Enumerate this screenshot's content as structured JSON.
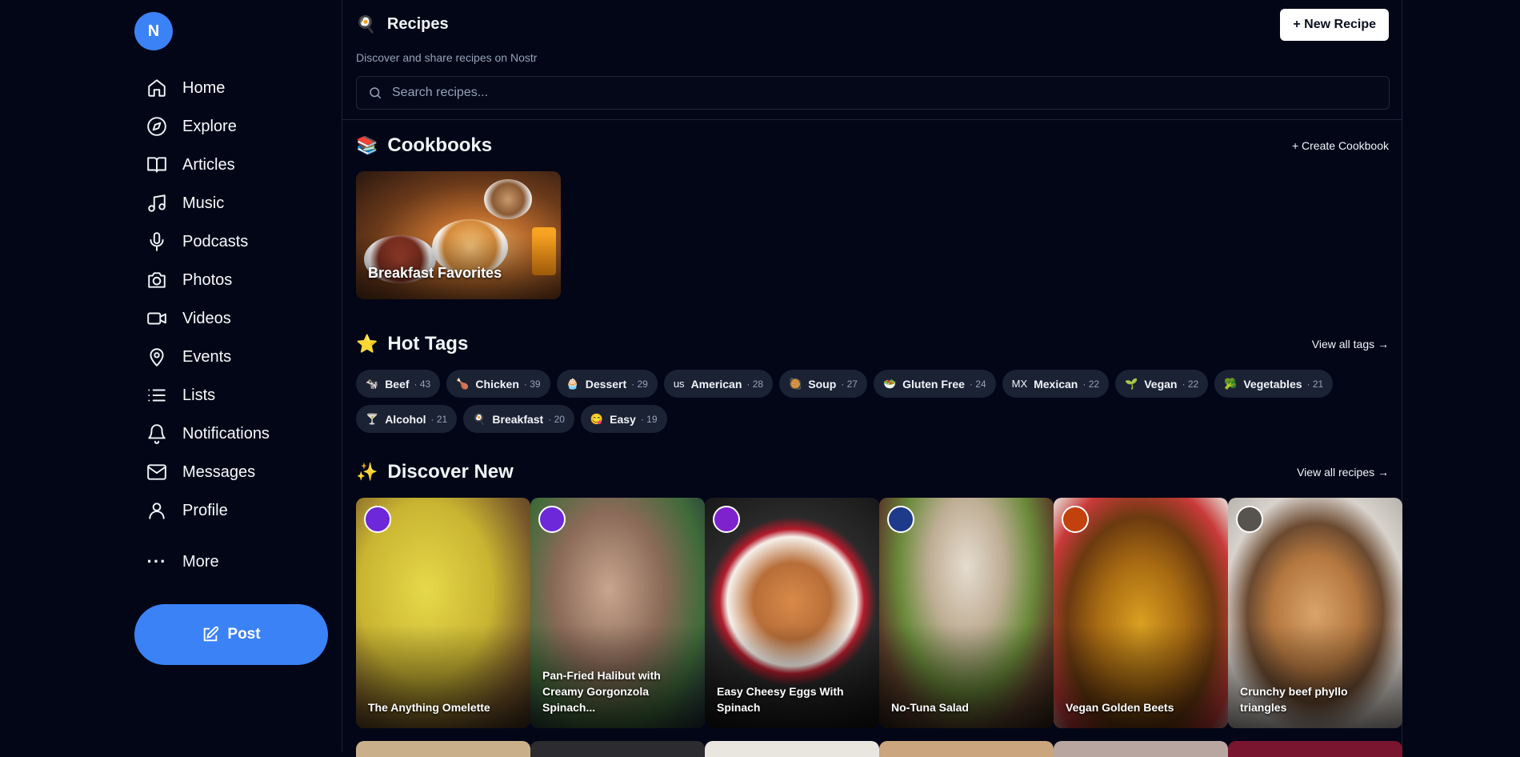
{
  "user": {
    "avatar_initial": "N"
  },
  "nav": [
    {
      "label": "Home",
      "icon": "home-icon"
    },
    {
      "label": "Explore",
      "icon": "compass-icon"
    },
    {
      "label": "Articles",
      "icon": "book-icon"
    },
    {
      "label": "Music",
      "icon": "music-icon"
    },
    {
      "label": "Podcasts",
      "icon": "mic-icon"
    },
    {
      "label": "Photos",
      "icon": "camera-icon"
    },
    {
      "label": "Videos",
      "icon": "video-icon"
    },
    {
      "label": "Events",
      "icon": "map-pin-icon"
    },
    {
      "label": "Lists",
      "icon": "list-icon"
    },
    {
      "label": "Notifications",
      "icon": "bell-icon"
    },
    {
      "label": "Messages",
      "icon": "mail-icon"
    },
    {
      "label": "Profile",
      "icon": "user-icon"
    }
  ],
  "more_label": "More",
  "post_label": "Post",
  "header": {
    "emoji": "🍳",
    "title": "Recipes",
    "subtitle": "Discover and share recipes on Nostr",
    "new_button": "+ New Recipe",
    "search_placeholder": "Search recipes..."
  },
  "cookbooks": {
    "emoji": "📚",
    "title": "Cookbooks",
    "create_label": "+ Create Cookbook",
    "items": [
      {
        "name": "Breakfast Favorites"
      }
    ]
  },
  "hot_tags": {
    "emoji": "⭐",
    "title": "Hot Tags",
    "view_all": "View all tags →",
    "items": [
      {
        "emoji": "🐄",
        "name": "Beef",
        "count": "· 43"
      },
      {
        "emoji": "🍗",
        "name": "Chicken",
        "count": "· 39"
      },
      {
        "emoji": "🧁",
        "name": "Dessert",
        "count": "· 29"
      },
      {
        "emoji": "us",
        "name": "American",
        "count": "· 28"
      },
      {
        "emoji": "🥘",
        "name": "Soup",
        "count": "· 27"
      },
      {
        "emoji": "🥗",
        "name": "Gluten Free",
        "count": "· 24"
      },
      {
        "emoji": "MX",
        "name": "Mexican",
        "count": "· 22"
      },
      {
        "emoji": "🌱",
        "name": "Vegan",
        "count": "· 22"
      },
      {
        "emoji": "🥦",
        "name": "Vegetables",
        "count": "· 21"
      },
      {
        "emoji": "🍸",
        "name": "Alcohol",
        "count": "· 21"
      },
      {
        "emoji": "🍳",
        "name": "Breakfast",
        "count": "· 20"
      },
      {
        "emoji": "😋",
        "name": "Easy",
        "count": "· 19"
      }
    ]
  },
  "discover": {
    "emoji": "✨",
    "title": "Discover New",
    "view_all": "View all recipes →",
    "recipes": [
      {
        "title": "The Anything Omelette"
      },
      {
        "title": "Pan-Fried Halibut with Creamy Gorgonzola Spinach..."
      },
      {
        "title": "Easy Cheesy Eggs With Spinach"
      },
      {
        "title": "No-Tuna Salad"
      },
      {
        "title": "Vegan Golden Beets"
      },
      {
        "title": "Crunchy beef phyllo triangles"
      }
    ]
  }
}
